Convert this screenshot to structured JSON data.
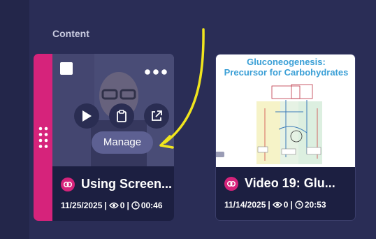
{
  "section": {
    "title": "Content"
  },
  "cards": [
    {
      "title": "Using Screen...",
      "date": "11/25/2025",
      "views": "0",
      "duration": "00:46",
      "manage_label": "Manage",
      "actions": [
        "play-icon",
        "clipboard-icon",
        "external-link-icon"
      ]
    },
    {
      "title": "Video 19: Glu...",
      "date": "11/14/2025",
      "views": "0",
      "duration": "20:53",
      "thumbnail": {
        "line1": "Gluconeogenesis:",
        "line2": "Precursor for Carbohydrates"
      }
    }
  ],
  "separator": "|",
  "colors": {
    "background": "#2a2d56",
    "card": "#1c1f41",
    "accent_pink": "#d6237b",
    "annotation_arrow": "#f0e51e"
  }
}
